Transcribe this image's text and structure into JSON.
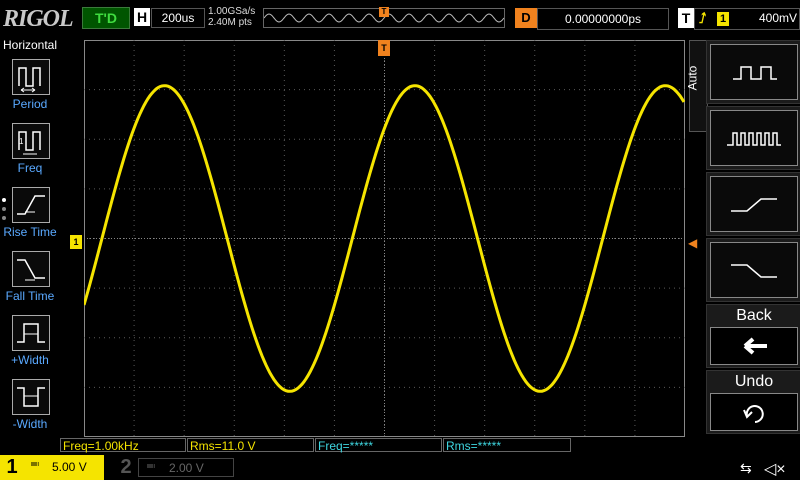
{
  "brand": "RIGOL",
  "header": {
    "run_status": "T'D",
    "horizontal_label": "H",
    "timebase": "200us",
    "sample_rate": "1.00GSa/s",
    "memory_depth": "2.40M pts",
    "trigger_pos_marker": "T",
    "delay_label": "D",
    "delay_value": "0.00000000ps",
    "trigger_label": "T",
    "trigger_source": "1",
    "trigger_level": "400mV"
  },
  "left_menu": {
    "title": "Horizontal",
    "items": [
      {
        "label": "Period",
        "icon": "period-icon"
      },
      {
        "label": "Freq",
        "icon": "frequency-icon"
      },
      {
        "label": "Rise Time",
        "icon": "rise-time-icon"
      },
      {
        "label": "Fall Time",
        "icon": "fall-time-icon"
      },
      {
        "label": "+Width",
        "icon": "positive-width-icon"
      },
      {
        "label": "-Width",
        "icon": "negative-width-icon"
      }
    ]
  },
  "waveform": {
    "channel_marker": "1",
    "trace_color": "#f5e400",
    "grid_color": "#5a5a5a",
    "periods_visible": 2.4
  },
  "measurements": [
    {
      "text": "Freq=1.00kHz",
      "color": "#f5e400"
    },
    {
      "text": "Rms=11.0 V",
      "color": "#f5e400"
    },
    {
      "text": "Freq=*****",
      "color": "#3fd6e0"
    },
    {
      "text": "Rms=*****",
      "color": "#3fd6e0"
    }
  ],
  "right_menu": {
    "tab": "Auto",
    "keys": [
      {
        "icon": "square-wave-icon"
      },
      {
        "icon": "pulse-train-icon"
      },
      {
        "icon": "rising-edge-icon"
      },
      {
        "icon": "falling-edge-icon"
      },
      {
        "label": "Back",
        "icon": "back-arrow-icon",
        "glyph": "🡐"
      },
      {
        "label": "Undo",
        "icon": "undo-icon",
        "glyph": "↶"
      }
    ]
  },
  "footer": {
    "ch1_label": "1",
    "ch1_scale": "5.00 V",
    "ch1_coupling": "≕",
    "ch2_label": "2",
    "ch2_scale": "2.00 V",
    "ch2_coupling": "≕",
    "usb_glyph": "⭠",
    "mute_glyph": "🔇"
  },
  "colors": {
    "ch1": "#f5e400",
    "trigger": "#f0821e",
    "menu_label": "#5aa9ff",
    "ch2_meas": "#3fd6e0"
  }
}
